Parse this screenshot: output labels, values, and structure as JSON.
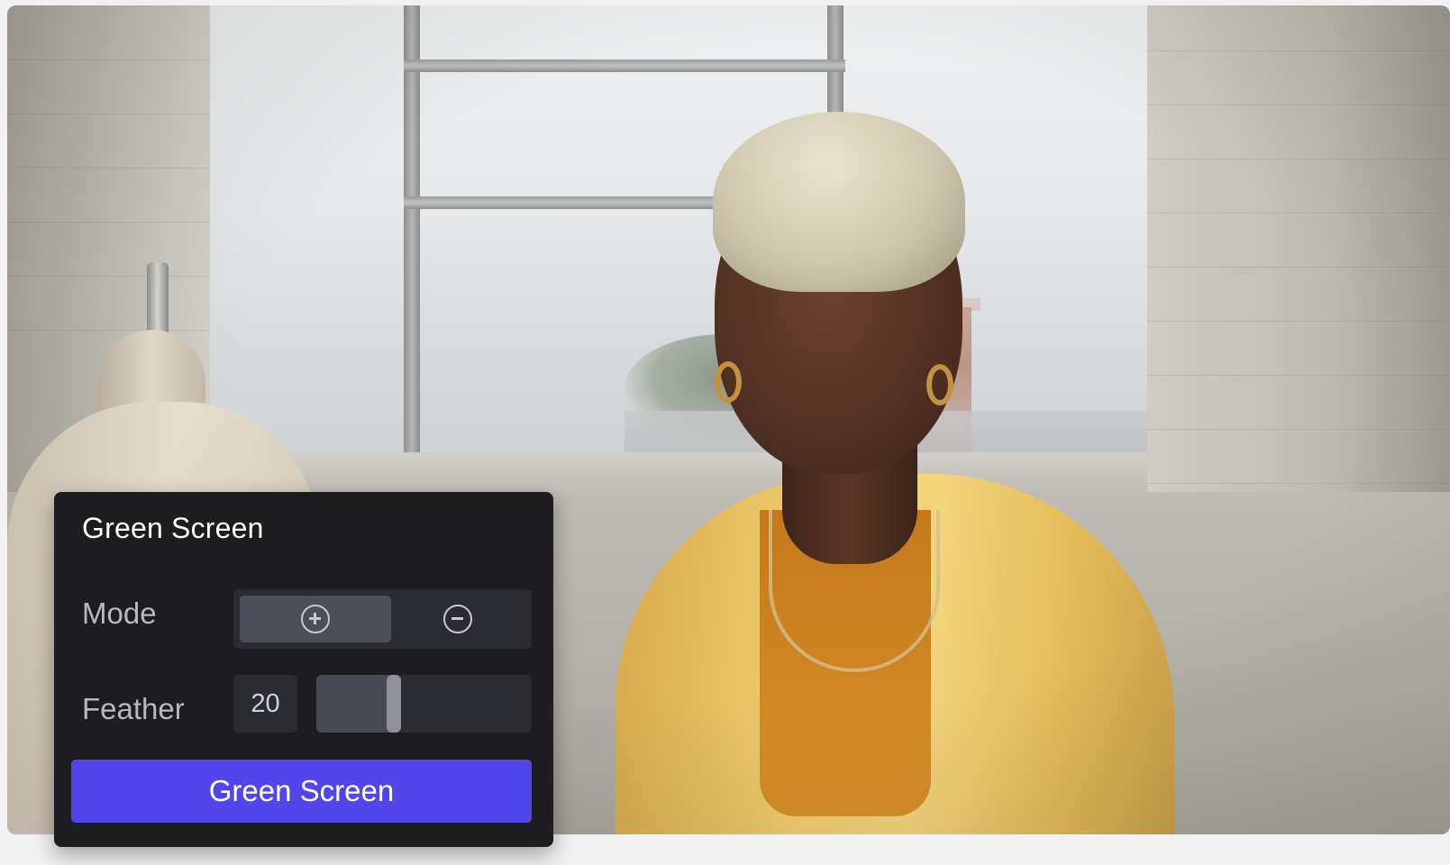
{
  "panel": {
    "title": "Green Screen",
    "mode": {
      "label": "Mode",
      "options": [
        {
          "icon": "plus-circle-icon",
          "selected": true
        },
        {
          "icon": "minus-circle-icon",
          "selected": false
        }
      ]
    },
    "feather": {
      "label": "Feather",
      "value": "20",
      "slider_level": 0.36
    },
    "action_button": {
      "label": "Green Screen",
      "color": "#5046e9"
    }
  },
  "colors": {
    "panel_bg": "#1d1d1f",
    "accent": "#5046e9"
  }
}
